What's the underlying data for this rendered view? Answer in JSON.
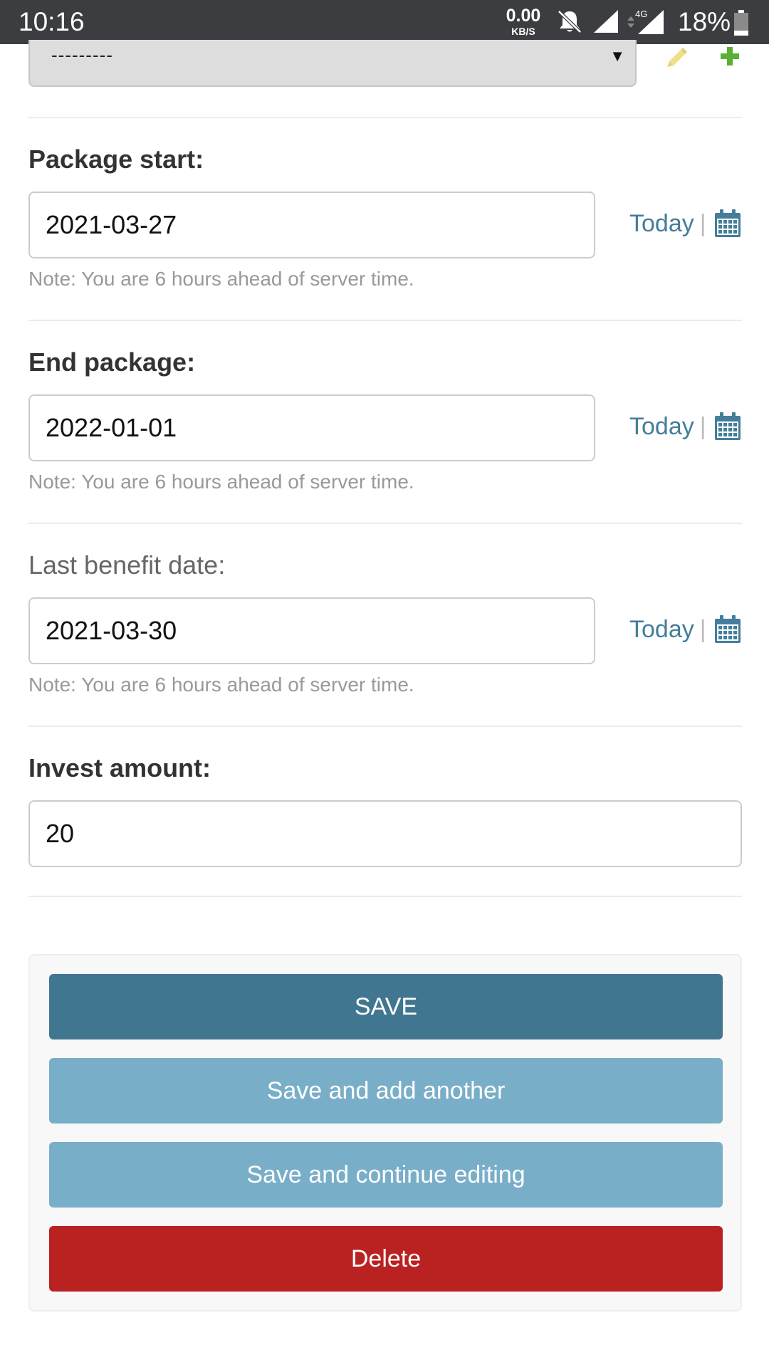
{
  "status_bar": {
    "time": "10:16",
    "net_speed": "0.00",
    "net_unit": "KB/S",
    "network_type": "4G",
    "battery": "18%"
  },
  "top_select": {
    "value": "---------",
    "arrow": "▼"
  },
  "fields": [
    {
      "label": "Package start:",
      "value": "2021-03-27",
      "today": "Today",
      "note": "Note: You are 6 hours ahead of server time."
    },
    {
      "label": "End package:",
      "value": "2022-01-01",
      "today": "Today",
      "note": "Note: You are 6 hours ahead of server time."
    },
    {
      "label": "Last benefit date:",
      "value": "2021-03-30",
      "today": "Today",
      "note": "Note: You are 6 hours ahead of server time."
    }
  ],
  "invest": {
    "label": "Invest amount:",
    "value": "20"
  },
  "separator": "|",
  "buttons": {
    "save": "SAVE",
    "save_add": "Save and add another",
    "save_continue": "Save and continue editing",
    "delete": "Delete"
  },
  "colors": {
    "primary": "#417690",
    "secondary": "#79aec8",
    "danger": "#ba2121",
    "link": "#447e9b"
  },
  "icons": [
    "bell-off-icon",
    "signal-icon",
    "battery-icon",
    "pencil-icon",
    "plus-icon",
    "calendar-icon"
  ]
}
